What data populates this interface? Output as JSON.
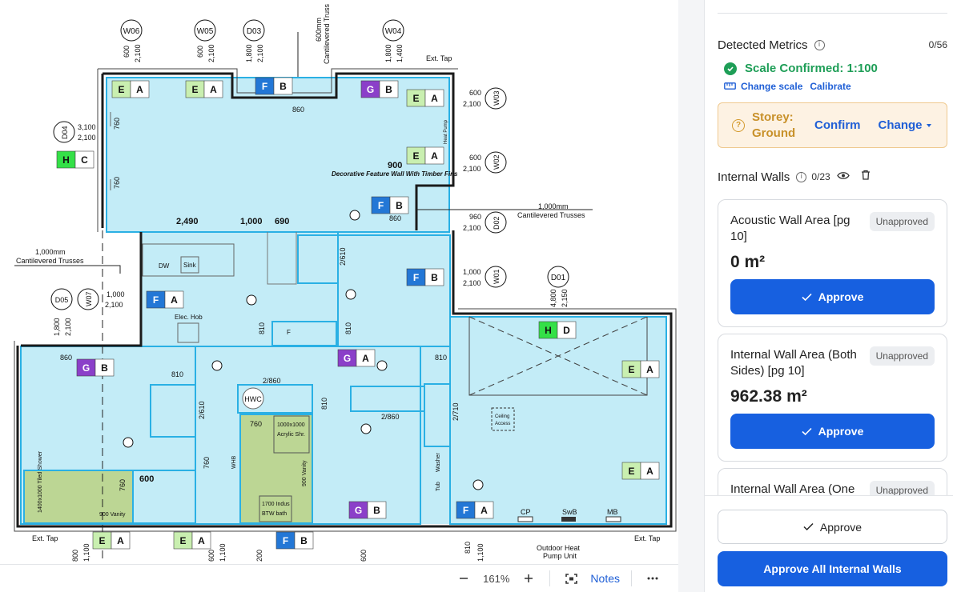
{
  "viewer": {
    "toolbar": {
      "zoom_out_icon": "minus",
      "zoom_value": "161%",
      "zoom_in_icon": "plus",
      "fit_icon": "fit-screen",
      "notes_label": "Notes",
      "more_icon": "ellipsis"
    },
    "plan": {
      "top_markers": [
        "W06",
        "W05",
        "D03",
        "W04"
      ],
      "top_dims": [
        [
          "600",
          "2,100"
        ],
        [
          "600",
          "2,100"
        ],
        [
          "1,800",
          "2,100"
        ],
        [
          "1,800",
          "1,400"
        ]
      ],
      "right_markers": [
        "W03",
        "W02",
        "D02",
        "W01",
        "D01"
      ],
      "right_dims": [
        [
          "600",
          "2,100"
        ],
        [
          "600",
          "2,100"
        ],
        [
          "960",
          "2,100"
        ],
        [
          "1,000",
          "2,100"
        ]
      ],
      "d01_dims": [
        "4,800",
        "2,150"
      ],
      "left_markers": [
        "D04",
        "D05",
        "W07"
      ],
      "d04_dims": [
        "3,100",
        "2,100"
      ],
      "w07_dims": [
        "1,000",
        "2,100"
      ],
      "d05_dims": [
        "1,800",
        "2,100"
      ],
      "texts": {
        "ext_tap": "Ext. Tap",
        "cantilevered_top": "Cantilevered Truss",
        "dim_600mm": "600mm",
        "cantilever_right_dim": "1,000mm",
        "cantilever_right": "Cantilevered Trusses",
        "cantilever_left_dim": "1,000mm",
        "cantilever_left": "Cantilevered Trusses",
        "feature_wall": "Decorative Feature Wall With Timber Fins",
        "heat_pump": "Heat Pump",
        "outdoor_heat_pump_1": "Outdoor Heat",
        "outdoor_heat_pump_2": "Pump Unit",
        "dw": "DW",
        "sink": "Sink",
        "elec_hob": "Elec. Hob",
        "hwc": "HWC",
        "acrylic_1": "1000x1000",
        "acrylic_2": "Acrylic Shr.",
        "vanity_900a": "900 Vanity",
        "vanity_900b": "900 Vanity",
        "bath_1": "1700 Indus",
        "bath_2": "BTW bath",
        "tiled_shower": "1400x1000 Tiled Shower",
        "ceiling_access_1": "Ceiling",
        "ceiling_access_2": "Access",
        "washer": "Washer",
        "tub": "Tub",
        "whb": "WHB",
        "cp": "CP",
        "swb": "SwB",
        "mb": "MB",
        "f": "F"
      },
      "dims": {
        "d860a": "860",
        "d760a": "760",
        "d760b": "760",
        "d900": "900",
        "d860b": "860",
        "d2490": "2,490",
        "d1000": "1,000",
        "d690": "690",
        "d2610a": "2/610",
        "d810a": "810",
        "d810b": "810",
        "d860c": "860",
        "d810c": "810",
        "d2860a": "2/860",
        "d810d": "810",
        "d2610b": "2/610",
        "d760c": "760",
        "d760d": "760",
        "d810e": "810",
        "d2860b": "2/860",
        "d2710": "2/710",
        "d760e": "760",
        "d600": "600",
        "bottom_dims": [
          "800",
          "1,100",
          "600",
          "1,100",
          "200",
          "600",
          "810",
          "1,100"
        ]
      },
      "tags": [
        [
          "E",
          "A"
        ],
        [
          "E",
          "A"
        ],
        [
          "F",
          "B"
        ],
        [
          "G",
          "B"
        ],
        [
          "E",
          "A"
        ],
        [
          "H",
          "C"
        ],
        [
          "E",
          "A"
        ],
        [
          "F",
          "B"
        ],
        [
          "F",
          "B"
        ],
        [
          "F",
          "A"
        ],
        [
          "H",
          "D"
        ],
        [
          "G",
          "B"
        ],
        [
          "G",
          "A"
        ],
        [
          "E",
          "A"
        ],
        [
          "E",
          "A"
        ],
        [
          "G",
          "B"
        ],
        [
          "F",
          "A"
        ],
        [
          "E",
          "A"
        ],
        [
          "E",
          "A"
        ],
        [
          "F",
          "B"
        ]
      ],
      "colors": {
        "room_fill": "#c3ecf7",
        "room_outline": "#2ab0e4",
        "bath_fill": "#bcd694",
        "tag_E": "#c9efb0",
        "tag_F": "#2377d6",
        "tag_G": "#8b3fc9",
        "tag_H": "#34e047"
      }
    }
  },
  "panel": {
    "detected_metrics": {
      "title": "Detected Metrics",
      "info_icon": "info-circle",
      "count": "0/56"
    },
    "scale": {
      "status": "Scale Confirmed: 1:100",
      "icon": "check-circle",
      "change_label": "Change scale",
      "ruler_icon": "ruler",
      "calibrate_label": "Calibrate"
    },
    "storey": {
      "icon": "help-circle",
      "label": "Storey: Ground",
      "confirm_label": "Confirm",
      "change_label": "Change"
    },
    "internal_walls": {
      "title": "Internal Walls",
      "info_icon": "info-circle",
      "count": "0/23",
      "eye_icon": "eye",
      "delete_icon": "trash"
    },
    "cards": [
      {
        "title": "Acoustic Wall Area [pg 10]",
        "status": "Unapproved",
        "value": "0 m²",
        "approve_label": "Approve"
      },
      {
        "title": "Internal Wall Area (Both Sides) [pg 10]",
        "status": "Unapproved",
        "value": "962.38 m²",
        "approve_label": "Approve"
      },
      {
        "title": "Internal Wall Area (One",
        "status": "Unapproved"
      }
    ],
    "bottom": {
      "approve_label": "Approve",
      "approve_all_label": "Approve All Internal Walls"
    }
  }
}
